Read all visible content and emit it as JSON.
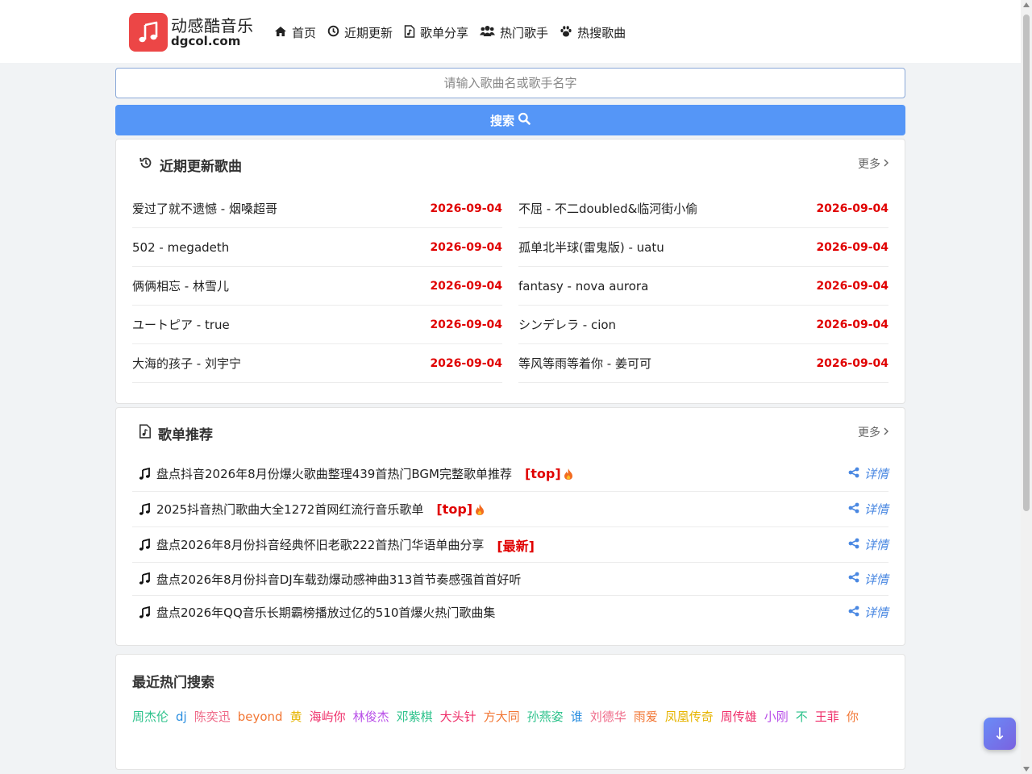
{
  "brand": {
    "title": "动感酷音乐",
    "domain": "dgcol.com",
    "color": "#ec4646"
  },
  "nav": [
    {
      "label": "首页",
      "icon": "home-icon"
    },
    {
      "label": "近期更新",
      "icon": "clock-icon"
    },
    {
      "label": "歌单分享",
      "icon": "file-music-icon"
    },
    {
      "label": "热门歌手",
      "icon": "users-icon"
    },
    {
      "label": "热搜歌曲",
      "icon": "paw-icon"
    }
  ],
  "search": {
    "placeholder": "请输入歌曲名或歌手名字",
    "button_label": "搜索",
    "button_color": "#5596f7"
  },
  "recent": {
    "title": "近期更新歌曲",
    "more_label": "更多",
    "left": [
      {
        "title": "爱过了就不遗憾 - 烟嗓超哥",
        "date": "2026-09-04"
      },
      {
        "title": "502 - megadeth",
        "date": "2026-09-04"
      },
      {
        "title": "俩俩相忘 - 林雪儿",
        "date": "2026-09-04"
      },
      {
        "title": "ユートピア - true",
        "date": "2026-09-04"
      },
      {
        "title": "大海的孩子 - 刘宇宁",
        "date": "2026-09-04"
      }
    ],
    "right": [
      {
        "title": "不屈 - 不二doubled&临河街小偷",
        "date": "2026-09-04"
      },
      {
        "title": "孤单北半球(雷鬼版) - uatu",
        "date": "2026-09-04"
      },
      {
        "title": "fantasy - nova aurora",
        "date": "2026-09-04"
      },
      {
        "title": "シンデレラ - cion",
        "date": "2026-09-04"
      },
      {
        "title": "等风等雨等着你 - 姜可可",
        "date": "2026-09-04"
      }
    ]
  },
  "playlists": {
    "title": "歌单推荐",
    "more_label": "更多",
    "detail_label": "详情",
    "items": [
      {
        "title": "盘点抖音2026年8月份爆火歌曲整理439首热门BGM完整歌单推荐",
        "tag": "[top]",
        "fire": true
      },
      {
        "title": "2025抖音热门歌曲大全1272首网红流行音乐歌单",
        "tag": "[top]",
        "fire": true
      },
      {
        "title": "盘点2026年8月份抖音经典怀旧老歌222首热门华语单曲分享",
        "tag": "[最新]",
        "fire": false
      },
      {
        "title": "盘点2026年8月份抖音DJ车载劲爆动感神曲313首节奏感强首首好听",
        "tag": "",
        "fire": false
      },
      {
        "title": "盘点2026年QQ音乐长期霸榜播放过亿的510首爆火热门歌曲集",
        "tag": "",
        "fire": false
      }
    ]
  },
  "hot": {
    "title": "最近热门搜索",
    "items": [
      {
        "label": "周杰伦",
        "color": "#2cc28b"
      },
      {
        "label": "dj",
        "color": "#2b8fe0"
      },
      {
        "label": "陈奕迅",
        "color": "#ef6a88"
      },
      {
        "label": "beyond",
        "color": "#f27735"
      },
      {
        "label": "黄",
        "color": "#e6b400"
      },
      {
        "label": "海屿你",
        "color": "#ef2f6a"
      },
      {
        "label": "林俊杰",
        "color": "#b84ee8"
      },
      {
        "label": "邓紫棋",
        "color": "#2cc28b"
      },
      {
        "label": "大头针",
        "color": "#ef2f6a"
      },
      {
        "label": "方大同",
        "color": "#f27735"
      },
      {
        "label": "孙燕姿",
        "color": "#2cc28b"
      },
      {
        "label": "谁",
        "color": "#2b8fe0"
      },
      {
        "label": "刘德华",
        "color": "#ef6a88"
      },
      {
        "label": "雨爱",
        "color": "#f27735"
      },
      {
        "label": "凤凰传奇",
        "color": "#e6b400"
      },
      {
        "label": "周传雄",
        "color": "#ef2f6a"
      },
      {
        "label": "小刚",
        "color": "#b84ee8"
      },
      {
        "label": "不",
        "color": "#2cc28b"
      },
      {
        "label": "王菲",
        "color": "#ef2f6a"
      },
      {
        "label": "你",
        "color": "#f27735"
      }
    ]
  },
  "fab": {
    "label": "↓"
  }
}
